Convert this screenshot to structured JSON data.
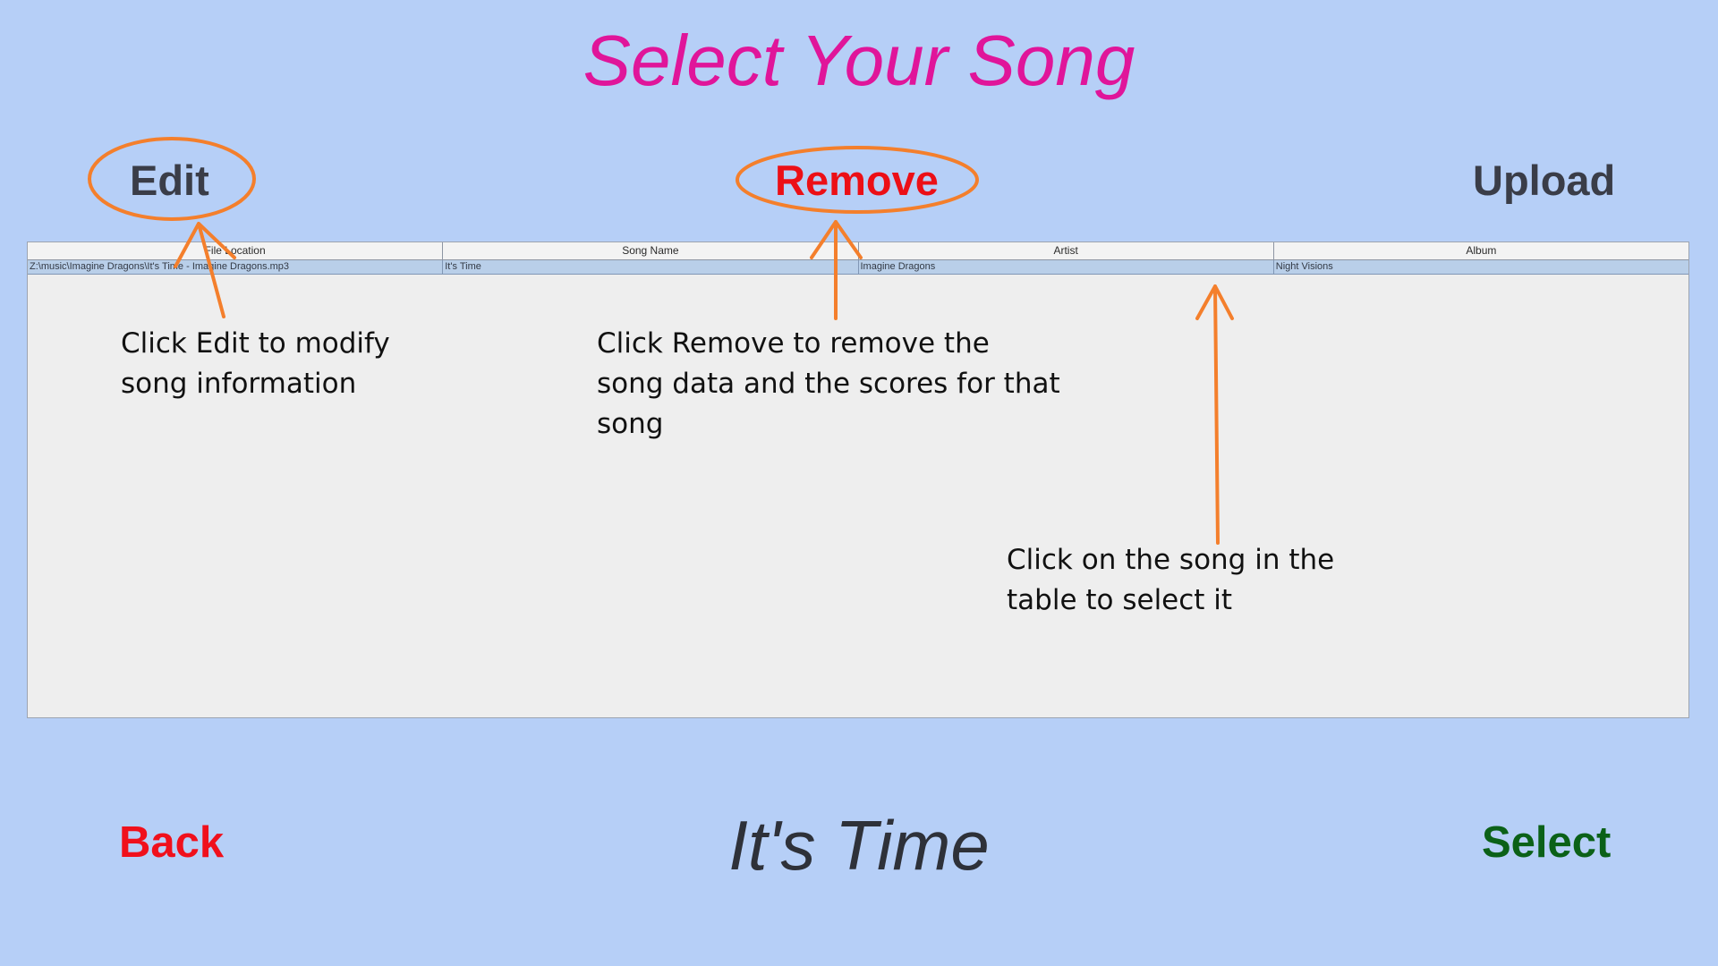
{
  "title": "Select Your Song",
  "actions": {
    "edit": "Edit",
    "remove": "Remove",
    "upload": "Upload"
  },
  "table": {
    "columns": [
      "File Location",
      "Song Name",
      "Artist",
      "Album"
    ],
    "rows": [
      [
        "Z:\\music\\Imagine Dragons\\It's Time - Imagine Dragons.mp3",
        "It's Time",
        "Imagine Dragons",
        "Night Visions"
      ]
    ]
  },
  "notes": {
    "edit": "Click Edit to modify song information",
    "remove": "Click Remove to remove the song data and the scores for that song",
    "select": "Click on the song in the table to select it"
  },
  "annotation_color": "#f47f2c",
  "bottom": {
    "back": "Back",
    "current_song": "It's Time",
    "select": "Select"
  }
}
